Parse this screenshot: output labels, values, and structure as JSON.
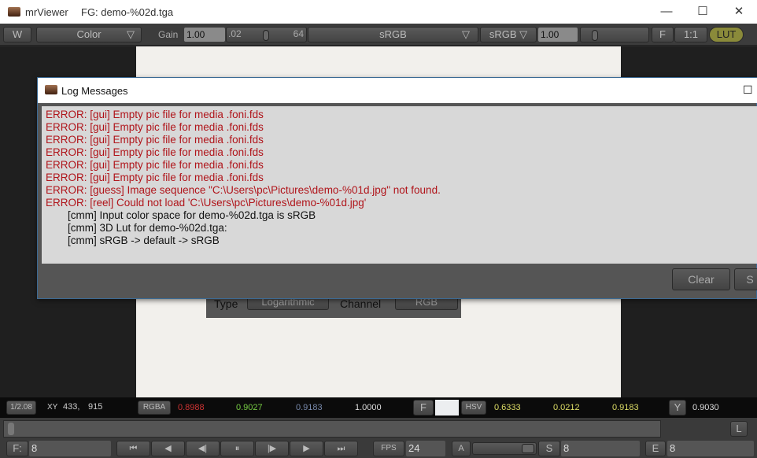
{
  "window": {
    "app": "mrViewer",
    "title": "FG: demo-%02d.tga",
    "minimize": "—",
    "maximize": "☐",
    "close": "✕"
  },
  "toolbar": {
    "w": "W",
    "channel": "Color",
    "gain_label": "Gain",
    "gain": "1.00",
    "gamma_min": ".02",
    "gamma_max": "64",
    "input_space": "sRGB",
    "output_space": "sRGB",
    "gamma": "1.00",
    "f": "F",
    "ratio": "1:1",
    "lut": "LUT"
  },
  "background_panel": {
    "type_label": "Type",
    "type_value": "Logarithmic",
    "channel_label": "Channel",
    "channel_value": "RGB"
  },
  "log_dialog": {
    "title": "Log Messages",
    "maximize": "☐",
    "clear": "Clear",
    "save": "S",
    "messages": [
      {
        "level": "error",
        "text": "ERROR: [gui] Empty pic file for media .foni.fds"
      },
      {
        "level": "error",
        "text": "ERROR: [gui] Empty pic file for media .foni.fds"
      },
      {
        "level": "error",
        "text": "ERROR: [gui] Empty pic file for media .foni.fds"
      },
      {
        "level": "error",
        "text": "ERROR: [gui] Empty pic file for media .foni.fds"
      },
      {
        "level": "error",
        "text": "ERROR: [gui] Empty pic file for media .foni.fds"
      },
      {
        "level": "error",
        "text": "ERROR: [gui] Empty pic file for media .foni.fds"
      },
      {
        "level": "error",
        "text": "ERROR: [guess] Image sequence \"C:\\Users\\pc\\Pictures\\demo-%01d.jpg\" not found."
      },
      {
        "level": "error",
        "text": "ERROR: [reel] Could not load 'C:\\Users\\pc\\Pictures\\demo-%01d.jpg'"
      },
      {
        "level": "info",
        "text": "[cmm] Input color space for demo-%02d.tga is sRGB"
      },
      {
        "level": "info",
        "text": "[cmm] 3D Lut for demo-%02d.tga:"
      },
      {
        "level": "info",
        "text": "[cmm] sRGB -> default -> sRGB"
      }
    ]
  },
  "pixel_bar": {
    "zoom": "1/2.08",
    "xy_label": "XY",
    "x": "433,",
    "y": "915",
    "rgba": "RGBA",
    "r": "0.8988",
    "g": "0.9027",
    "b": "0.9183",
    "a": "1.0000",
    "f": "F",
    "hsv": "HSV",
    "h": "0.6333",
    "s": "0.0212",
    "v": "0.9183",
    "y_btn": "Y",
    "luma": "0.9030"
  },
  "timeline": {
    "l": "L"
  },
  "controls": {
    "frame_label": "F:",
    "frame": "8",
    "fps_label": "FPS",
    "fps": "24",
    "a": "A",
    "start_label": "S",
    "start": "8",
    "end_label": "E",
    "end": "8",
    "transport": [
      "⏮",
      "◀",
      "◀|",
      "⏸",
      "|▶",
      "▶",
      "⏭"
    ]
  },
  "colors": {
    "error": "#b0141a",
    "lut_button": "#8a8a3a"
  }
}
